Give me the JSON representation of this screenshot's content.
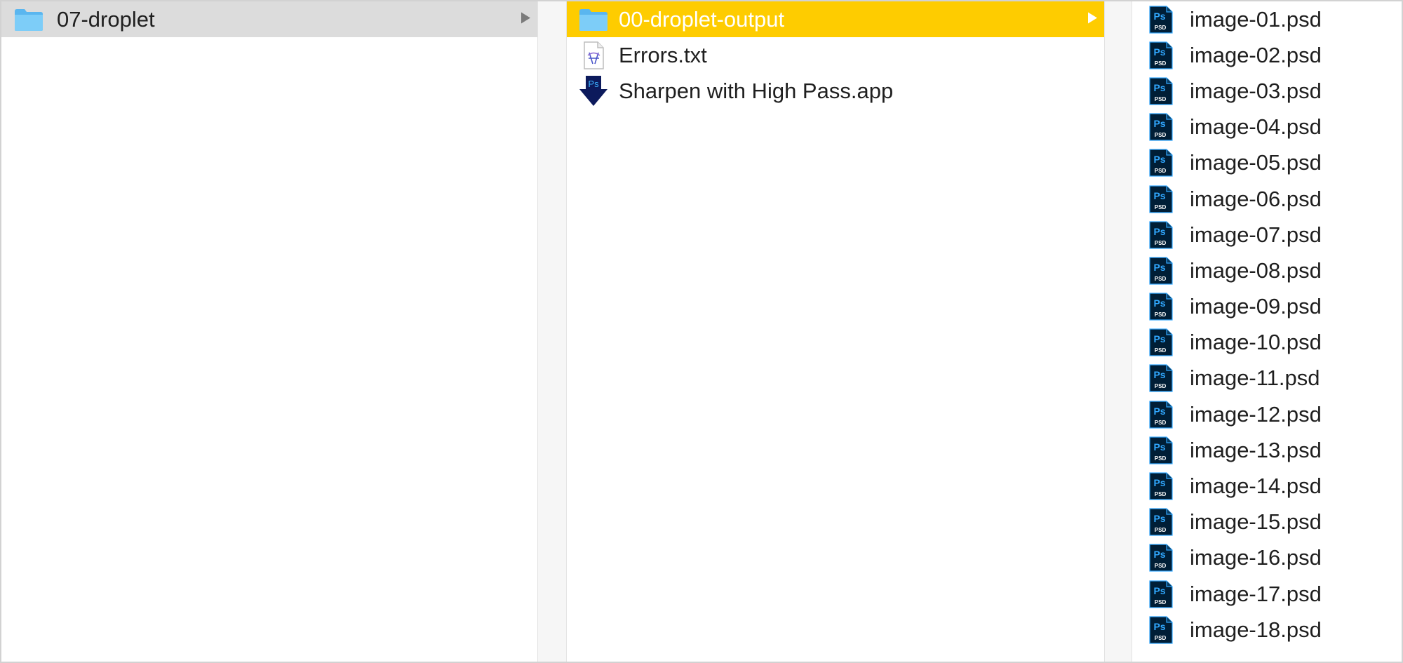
{
  "columns": {
    "col1": {
      "items": [
        {
          "label": "07-droplet",
          "icon": "folder-icon",
          "selected": "gray"
        }
      ]
    },
    "col2": {
      "items": [
        {
          "label": "00-droplet-output",
          "icon": "folder-icon",
          "selected": "yellow"
        },
        {
          "label": "Errors.txt",
          "icon": "text-file-icon"
        },
        {
          "label": "Sharpen with High Pass.app",
          "icon": "photoshop-droplet-icon"
        }
      ]
    },
    "col3": {
      "items": [
        {
          "label": "image-01.psd"
        },
        {
          "label": "image-02.psd"
        },
        {
          "label": "image-03.psd"
        },
        {
          "label": "image-04.psd"
        },
        {
          "label": "image-05.psd"
        },
        {
          "label": "image-06.psd"
        },
        {
          "label": "image-07.psd"
        },
        {
          "label": "image-08.psd"
        },
        {
          "label": "image-09.psd"
        },
        {
          "label": "image-10.psd"
        },
        {
          "label": "image-11.psd"
        },
        {
          "label": "image-12.psd"
        },
        {
          "label": "image-13.psd"
        },
        {
          "label": "image-14.psd"
        },
        {
          "label": "image-15.psd"
        },
        {
          "label": "image-16.psd"
        },
        {
          "label": "image-17.psd"
        },
        {
          "label": "image-18.psd"
        }
      ]
    }
  },
  "icons": {
    "psd_label": "PSD",
    "ps_label": "Ps"
  },
  "colors": {
    "selection_active": "#fecc00",
    "selection_inactive": "#dcdcdc",
    "folder": "#6cc4f5",
    "ps_blue": "#31a8ff",
    "ps_dark": "#001e36"
  }
}
